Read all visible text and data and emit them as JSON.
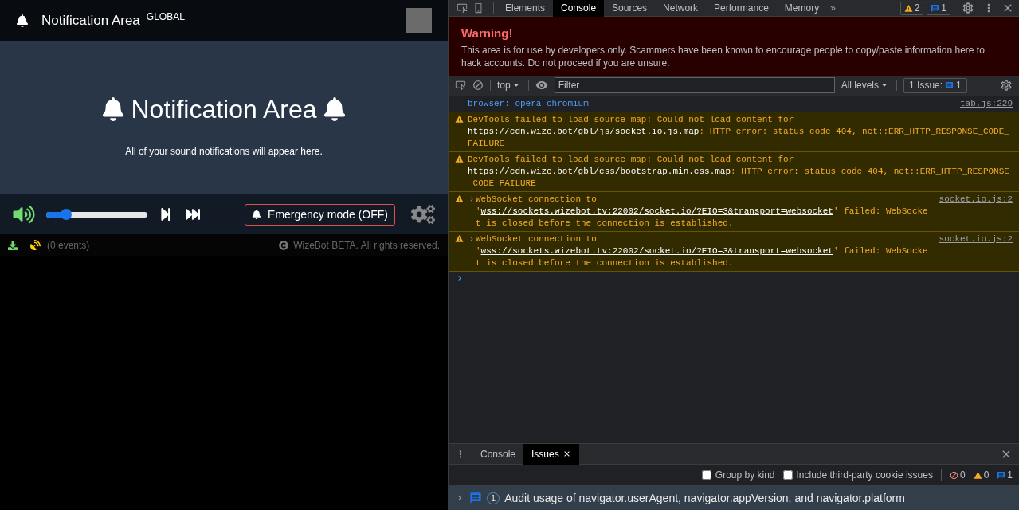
{
  "app": {
    "header": {
      "title": "Notification Area",
      "badge": "GLOBAL"
    },
    "hero": {
      "title": "Notification Area",
      "subtitle": "All of your sound notifications will appear here."
    },
    "controls": {
      "volume": {
        "level": 0.2
      },
      "emergency_button": "Emergency mode (OFF)"
    },
    "footer": {
      "events": "(0 events)",
      "copyright": "WizeBot BETA. All rights reserved."
    }
  },
  "devtools": {
    "tabs": [
      {
        "label": "Elements",
        "selected": false
      },
      {
        "label": "Console",
        "selected": true
      },
      {
        "label": "Sources",
        "selected": false
      },
      {
        "label": "Network",
        "selected": false
      },
      {
        "label": "Performance",
        "selected": false
      },
      {
        "label": "Memory",
        "selected": false
      }
    ],
    "more": "»",
    "warning_count": "2",
    "message_count": "1",
    "banner": {
      "title": "Warning!",
      "text": "This area is for use by developers only. Scammers have been known to encourage people to copy/paste information here to hack accounts. Do not proceed if you are unsure."
    },
    "toolbar": {
      "context": "top",
      "filter_placeholder": "Filter",
      "levels": "All levels",
      "issues_label": "1 Issue:",
      "issues_count": "1"
    },
    "messages": [
      {
        "kind": "info",
        "expandable": false,
        "parts": [
          {
            "text": "browser: opera-chromium",
            "link": false
          }
        ],
        "source": "tab.js:229"
      },
      {
        "kind": "warning",
        "expandable": false,
        "parts": [
          {
            "text": "DevTools failed to load source map: Could not load content for ",
            "link": false
          },
          {
            "text": "https://cdn.wize.bot/gbl/js/socket.io.js.map",
            "link": true
          },
          {
            "text": ": HTTP error: status code 404, net::ERR_HTTP_RESPONSE_CODE_FAILURE",
            "link": false
          }
        ]
      },
      {
        "kind": "warning",
        "expandable": false,
        "parts": [
          {
            "text": "DevTools failed to load source map: Could not load content for ",
            "link": false
          },
          {
            "text": "https://cdn.wize.bot/gbl/css/bootstrap.min.css.map",
            "link": true
          },
          {
            "text": ": HTTP error: status code 404, net::ERR_HTTP_RESPONSE_CODE_FAILURE",
            "link": false
          }
        ]
      },
      {
        "kind": "warning",
        "expandable": true,
        "parts": [
          {
            "text": "WebSocket connection to '",
            "link": false
          },
          {
            "text": "wss://sockets.wizebot.tv:22002/socket.io/?EIO=3&transport=websocket",
            "link": true
          },
          {
            "text": "' failed: WebSocket is closed before the connection is established.",
            "link": false
          }
        ],
        "source": "socket.io.js:2"
      },
      {
        "kind": "warning",
        "expandable": true,
        "parts": [
          {
            "text": "WebSocket connection to '",
            "link": false
          },
          {
            "text": "wss://sockets.wizebot.tv:22002/socket.io/?EIO=3&transport=websocket",
            "link": true
          },
          {
            "text": "' failed: WebSocket is closed before the connection is established.",
            "link": false
          }
        ],
        "source": "socket.io.js:2"
      }
    ],
    "drawer": {
      "tabs": [
        {
          "label": "Console",
          "selected": false,
          "closable": false
        },
        {
          "label": "Issues",
          "selected": true,
          "closable": true
        }
      ],
      "options": [
        {
          "label": "Group by kind",
          "checked": false
        },
        {
          "label": "Include third-party cookie issues",
          "checked": false
        }
      ],
      "error_count": "0",
      "warning_count": "0",
      "info_count": "1",
      "issue": {
        "count": "1",
        "text": "Audit usage of navigator.userAgent, navigator.appVersion, and navigator.platform"
      }
    }
  }
}
